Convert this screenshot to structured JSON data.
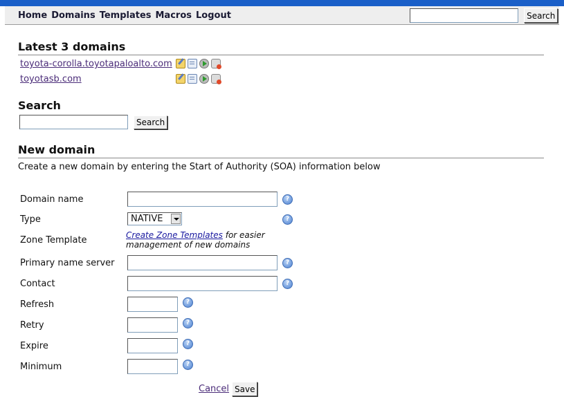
{
  "nav": {
    "links": [
      "Home",
      "Domains",
      "Templates",
      "Macros",
      "Logout"
    ],
    "search_button": "Search"
  },
  "latest": {
    "heading": "Latest 3 domains",
    "domains": [
      "toyota-corolla.toyotapaloalto.com",
      "toyotasb.com"
    ]
  },
  "search": {
    "heading": "Search",
    "button": "Search"
  },
  "new_domain": {
    "heading": "New domain",
    "description": "Create a new domain by entering the Start of Authority (SOA) information below",
    "labels": {
      "domain_name": "Domain name",
      "type": "Type",
      "zone_template": "Zone Template",
      "primary_ns": "Primary name server",
      "contact": "Contact",
      "refresh": "Refresh",
      "retry": "Retry",
      "expire": "Expire",
      "minimum": "Minimum"
    },
    "type_value": "NATIVE",
    "zone_template_link": "Create Zone Templates",
    "zone_template_text1": "for easier",
    "zone_template_text2": "management of new domains",
    "cancel": "Cancel",
    "save": "Save"
  },
  "colors": {
    "top_stripe": "#1a5fc8",
    "link": "#4a2b78",
    "template_link": "#1a1aa0"
  },
  "icons": [
    "edit-icon",
    "template-icon",
    "move-icon",
    "delete-icon",
    "help-icon"
  ]
}
